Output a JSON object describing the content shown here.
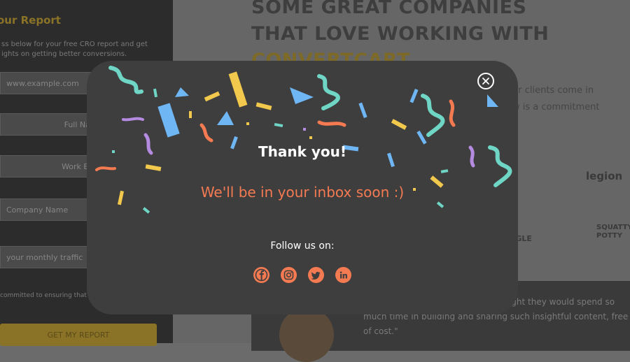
{
  "background": {
    "form": {
      "title": "our Report",
      "description": "ss below for your free CRO report and get ights on getting better conversions.",
      "fields": [
        {
          "value": "www.example.com"
        },
        {
          "value": "Full Name"
        },
        {
          "value": "Work Email"
        },
        {
          "value": "Company Name"
        },
        {
          "value": "your monthly traffic"
        }
      ],
      "consent": "committed to ensuring that your",
      "submit_label": "GET MY REPORT"
    },
    "heading_line1": "SOME GREAT COMPANIES",
    "heading_line2": "THAT LOVE WORKING WITH",
    "heading_brand": "CONVERTCART",
    "paragraph": "ur clients come in\nw is a commitment",
    "logos": [
      "legion",
      "OGLE",
      "SQUATTY POTTY"
    ],
    "testimonial": "deep and insightful. We never thought they would spend so much time in building and sharing such insightful content, free of cost.\""
  },
  "modal": {
    "title": "Thank you!",
    "subtitle": "We'll be in your inbox soon :)",
    "follow_label": "Follow us on:",
    "socials": [
      {
        "name": "facebook-icon"
      },
      {
        "name": "instagram-icon"
      },
      {
        "name": "twitter-icon"
      },
      {
        "name": "linkedin-icon"
      }
    ],
    "colors": {
      "modal_bg": "#3e3e3e",
      "accent": "#f47a52",
      "title": "#ffffff",
      "confetti": [
        "#f2c94c",
        "#6fb6f5",
        "#6fd6c6",
        "#f47a52",
        "#b48be0"
      ]
    }
  }
}
